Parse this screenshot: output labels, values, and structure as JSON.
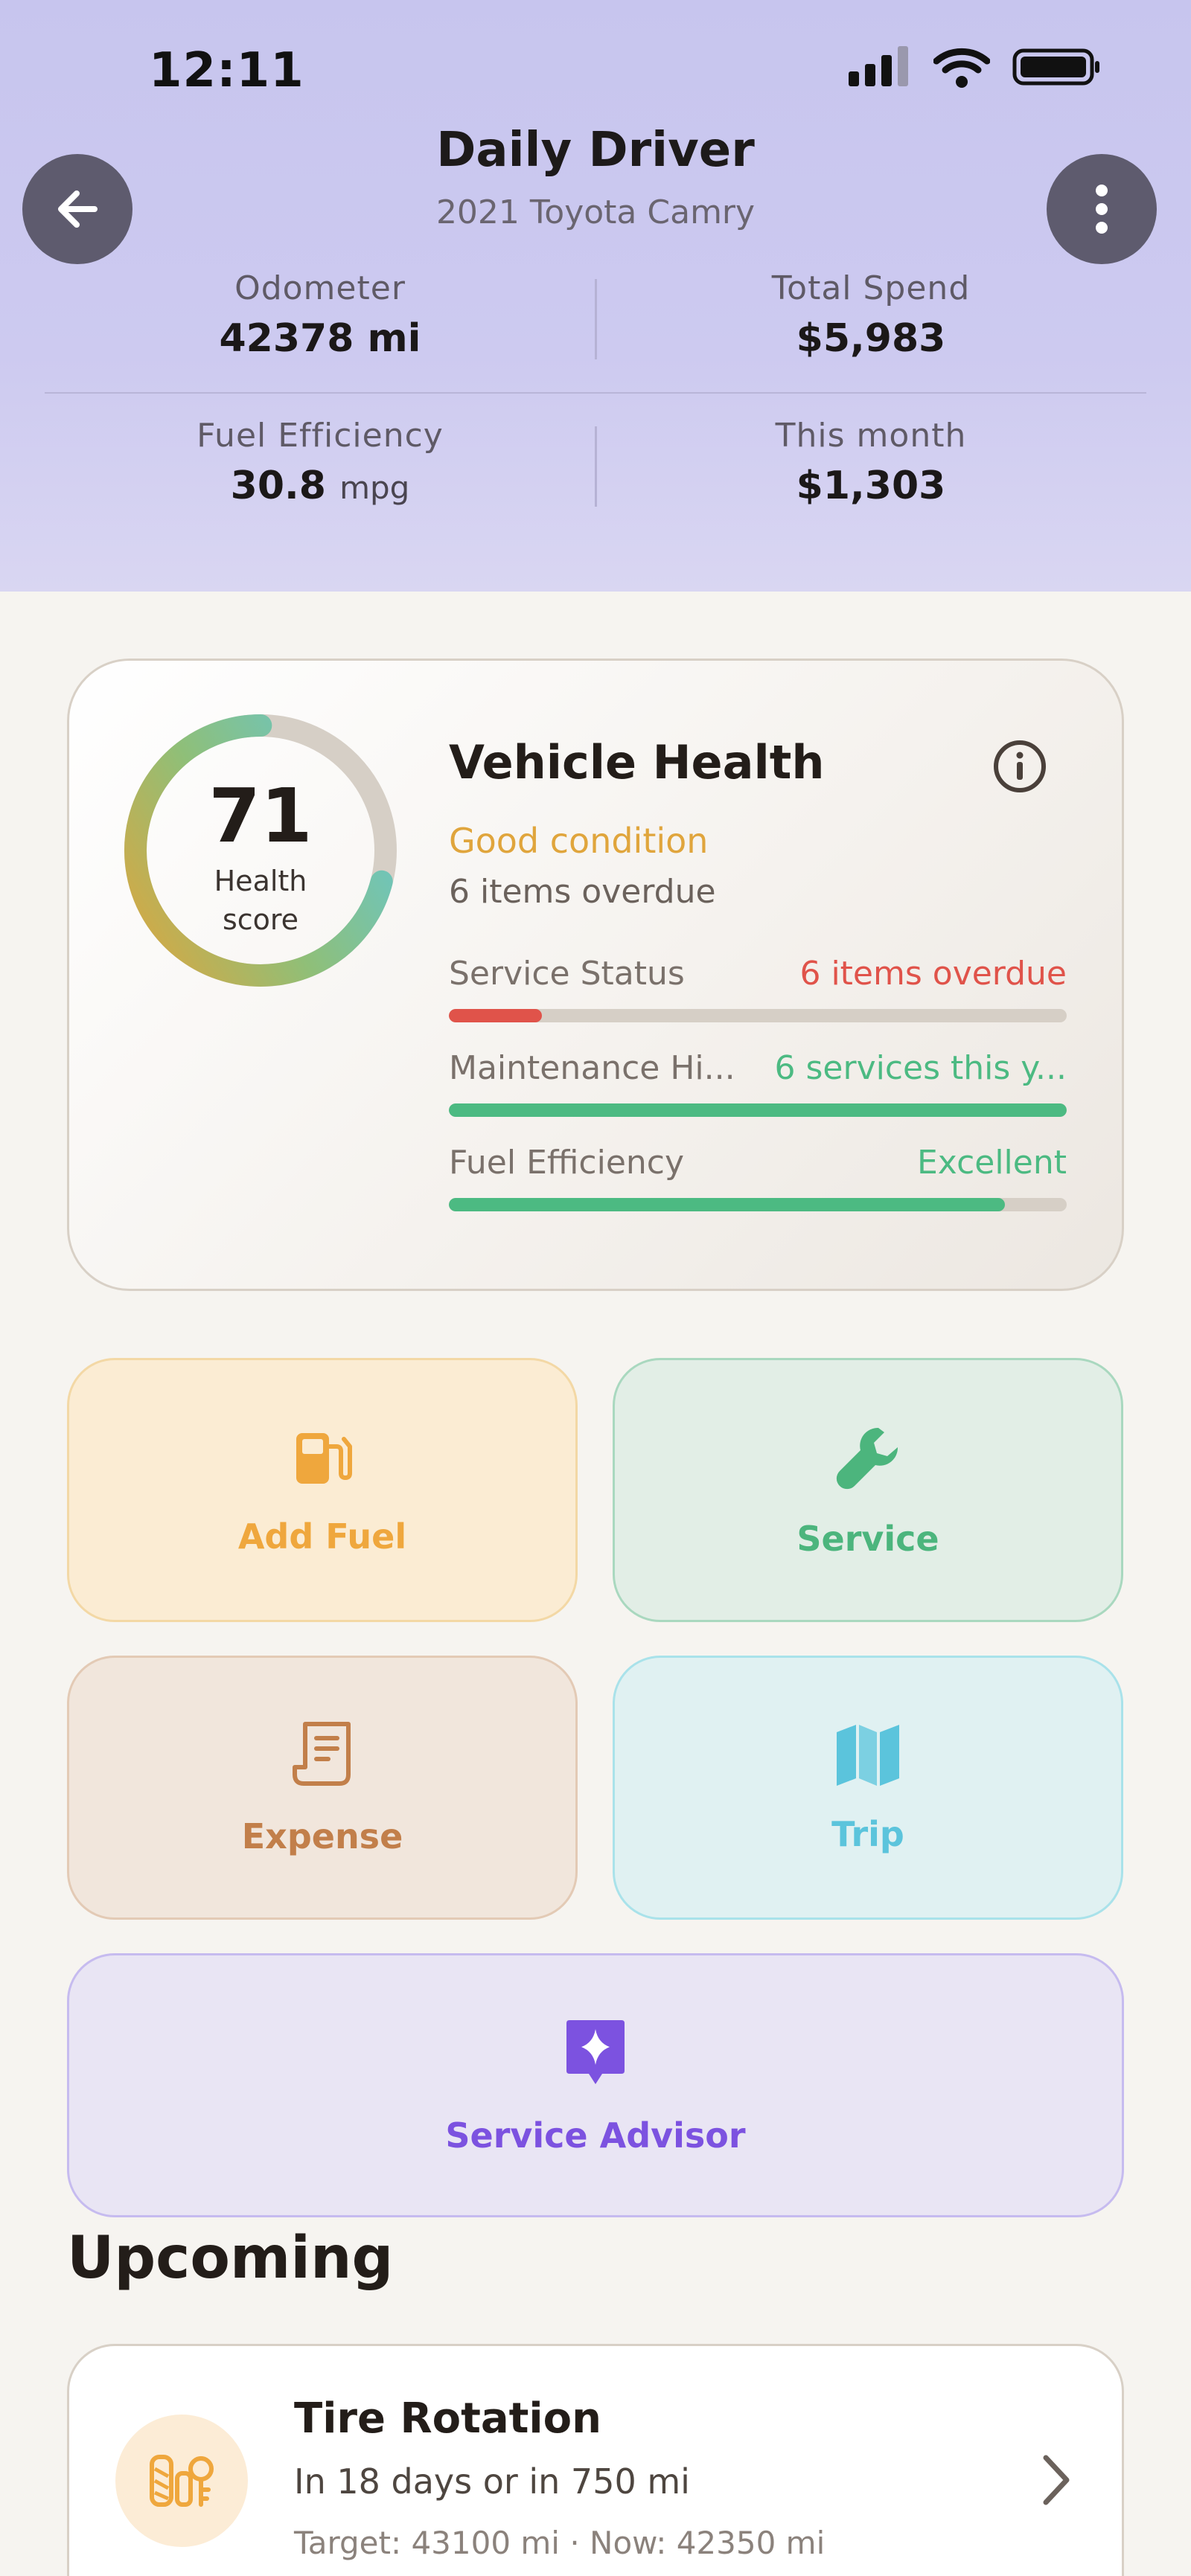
{
  "status_bar": {
    "time": "12:11"
  },
  "header": {
    "title": "Daily Driver",
    "subtitle": "2021 Toyota Camry",
    "stats": [
      {
        "label": "Odometer",
        "value": "42378 mi"
      },
      {
        "label": "Total Spend",
        "value": "$5,983"
      },
      {
        "label": "Fuel Efficiency",
        "value": "30.8",
        "unit": "mpg"
      },
      {
        "label": "This month",
        "value": "$1,303"
      }
    ]
  },
  "health": {
    "score": "71",
    "score_value": 71,
    "score_caption_line1": "Health",
    "score_caption_line2": "score",
    "title": "Vehicle Health",
    "status": "Good condition",
    "subtext": "6 items overdue",
    "metrics": [
      {
        "label": "Service Status",
        "value": "6 items overdue",
        "fill_fraction": 0.15,
        "color": "#e0534a"
      },
      {
        "label": "Maintenance Hi...",
        "value": "6 services this y...",
        "fill_fraction": 1.0,
        "color": "#4cba82"
      },
      {
        "label": "Fuel Efficiency",
        "value": "Excellent",
        "fill_fraction": 0.9,
        "color": "#4cba82"
      }
    ]
  },
  "actions": {
    "add_fuel": {
      "label": "Add Fuel",
      "icon": "fuel-pump-icon",
      "color": "#efa73d"
    },
    "service": {
      "label": "Service",
      "icon": "wrench-icon",
      "color": "#4cb57d"
    },
    "expense": {
      "label": "Expense",
      "icon": "receipt-icon",
      "color": "#c27f4a"
    },
    "trip": {
      "label": "Trip",
      "icon": "map-icon",
      "color": "#5bc4dc"
    },
    "advisor": {
      "label": "Service Advisor",
      "icon": "sparkle-chat-icon",
      "color": "#7c52e0"
    }
  },
  "upcoming": {
    "section_title": "Upcoming",
    "items": [
      {
        "title": "Tire Rotation",
        "subtitle": "In 18 days or in 750 mi",
        "detail": "Target: 43100 mi · Now: 42350 mi",
        "icon": "tire-rotation-icon"
      }
    ]
  }
}
